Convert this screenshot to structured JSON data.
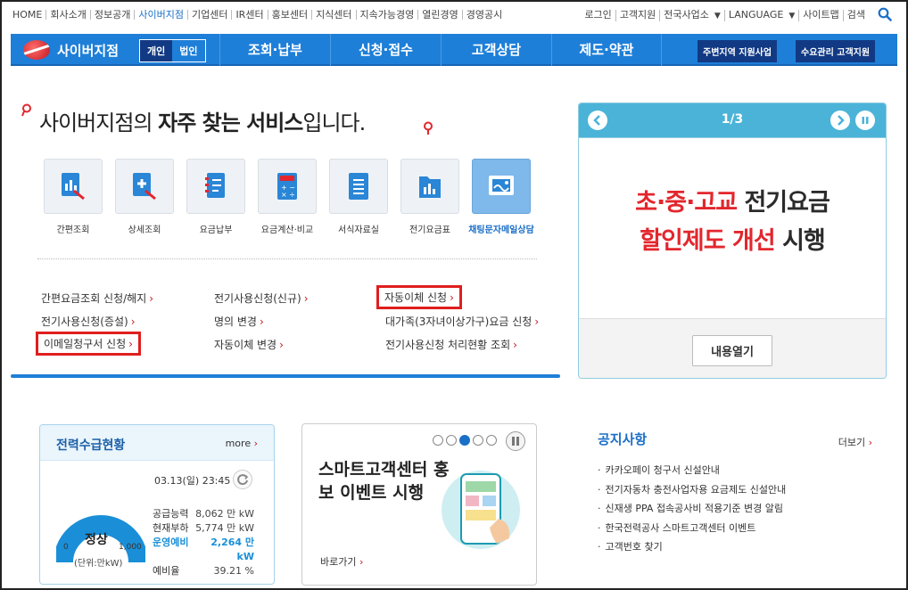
{
  "topbar": {
    "nav": [
      "HOME",
      "회사소개",
      "정보공개",
      "사이버지점",
      "기업센터",
      "IR센터",
      "홍보센터",
      "지식센터",
      "지속가능경영",
      "열린경영",
      "경영공시"
    ],
    "util": [
      "로그인",
      "고객지원",
      "전국사업소",
      "LANGUAGE",
      "사이트맵",
      "검색"
    ]
  },
  "mainnav": {
    "logo": "사이버지점",
    "personal": "개인",
    "corporate": "법인",
    "items": [
      "조회·납부",
      "신청·접수",
      "고객상담",
      "제도·약관"
    ],
    "btn1": "주변지역 지원사업",
    "btn2": "수요관리 고객지원"
  },
  "headline": {
    "pre": "사이버지점의 ",
    "bold": "자주 찾는 서비스",
    "post": "입니다."
  },
  "services": [
    {
      "label": "간편조회",
      "icon": "doc-chart-icon"
    },
    {
      "label": "상세조회",
      "icon": "doc-search-icon"
    },
    {
      "label": "요금납부",
      "icon": "notebook-icon"
    },
    {
      "label": "요금계산·비교",
      "icon": "calculator-icon"
    },
    {
      "label": "서식자료실",
      "icon": "form-list-icon"
    },
    {
      "label": "전기요금표",
      "icon": "folder-chart-icon"
    },
    {
      "label": "채팅문자메일상담",
      "icon": "chat-mail-icon"
    }
  ],
  "links": {
    "c1": [
      "간편요금조회 신청/해지",
      "전기사용신청(증설)",
      "이메일청구서 신청"
    ],
    "c2": [
      "전기사용신청(신규)",
      "명의 변경",
      "자동이체 변경"
    ],
    "c3": [
      "자동이체 신청",
      "대가족(3자녀이상가구)요금 신청",
      "전기사용신청 처리현황 조회"
    ]
  },
  "promo": {
    "pager": "1/3",
    "l1_red": "초·중·고교",
    "l1_dark": " 전기요금",
    "l2_red": "할인제도 개선",
    "l2_dark": " 시행",
    "button": "내용열기"
  },
  "power": {
    "title": "전력수급현황",
    "more": "more",
    "time": "03.13(일) 23:45",
    "status": "정상",
    "min": "0",
    "max": "1,000",
    "unit": "(단위:만kW)",
    "stats": [
      {
        "k": "공급능력",
        "v": "8,062 만 kW"
      },
      {
        "k": "현재부하",
        "v": "5,774 만 kW"
      },
      {
        "k": "운영예비",
        "v": "2,264 만 kW"
      },
      {
        "k": "예비율",
        "v": "39.21 %"
      }
    ]
  },
  "smart": {
    "title": "스마트고객센터 홍보 이벤트 시행",
    "link": "바로가기"
  },
  "notice": {
    "title": "공지사항",
    "more": "더보기",
    "items": [
      "카카오페이 청구서 신설안내",
      "전기자동차 충전사업자용 요금제도 신설안내",
      "신재생 PPA 접속공사비 적용기준 변경 알림",
      "한국전력공사 스마트고객센터 이벤트",
      "고객번호 찾기"
    ]
  },
  "colors": {
    "brand": "#1e7fd8",
    "accent_red": "#e3262d",
    "promo_head": "#4bb3d8"
  }
}
